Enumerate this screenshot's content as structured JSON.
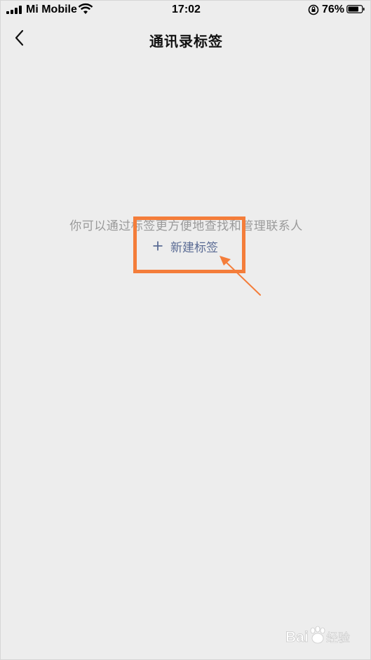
{
  "status_bar": {
    "carrier": "Mi Mobile",
    "time": "17:02",
    "battery": "76%"
  },
  "nav": {
    "title": "通讯录标签",
    "back_icon": "chevron-left-icon"
  },
  "empty_state": {
    "hint": "你可以通过标签更方便地查找和管理联系人",
    "new_tag_label": "新建标签"
  },
  "annotation": {
    "color": "#f47d3a"
  },
  "watermark": {
    "text": "Baidu经验"
  }
}
